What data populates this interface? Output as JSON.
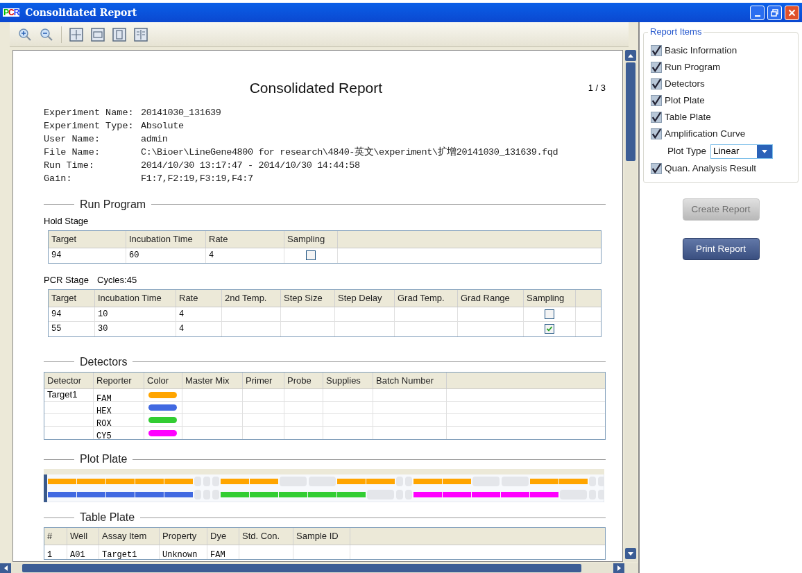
{
  "window": {
    "title": "Consolidated Report",
    "logo": "PCR"
  },
  "report": {
    "title": "Consolidated Report",
    "page": "1 / 3",
    "info": [
      {
        "label": "Experiment Name:",
        "value": "20141030_131639"
      },
      {
        "label": "Experiment Type:",
        "value": "Absolute"
      },
      {
        "label": "User Name:",
        "value": "admin"
      },
      {
        "label": "File Name:",
        "value": "C:\\Bioer\\LineGene4800 for research\\4840-英文\\experiment\\扩增20141030_131639.fqd"
      },
      {
        "label": "Run Time:",
        "value": "2014/10/30 13:17:47 - 2014/10/30 14:44:58"
      },
      {
        "label": "Gain:",
        "value": "F1:7,F2:19,F3:19,F4:7"
      }
    ],
    "run_program": {
      "heading": "Run Program",
      "hold_stage": {
        "label": "Hold Stage",
        "columns": [
          "Target",
          "Incubation Time",
          "Rate",
          "Sampling"
        ],
        "rows": [
          {
            "cells": [
              "94",
              "60",
              "4"
            ],
            "sampling": false
          }
        ]
      },
      "pcr_stage": {
        "label": "PCR Stage",
        "cycles": "Cycles:45",
        "columns": [
          "Target",
          "Incubation Time",
          "Rate",
          "2nd Temp.",
          "Step Size",
          "Step Delay",
          "Grad Temp.",
          "Grad Range",
          "Sampling"
        ],
        "rows": [
          {
            "cells": [
              "94",
              "10",
              "4"
            ],
            "sampling": false
          },
          {
            "cells": [
              "55",
              "30",
              "4"
            ],
            "sampling": true
          }
        ]
      }
    },
    "detectors": {
      "heading": "Detectors",
      "columns": [
        "Detector",
        "Reporter",
        "Color",
        "Master Mix",
        "Primer",
        "Probe",
        "Supplies",
        "Batch Number"
      ],
      "rows": [
        {
          "detector": "Target1",
          "reporter": "FAM",
          "color": "#ffa500"
        },
        {
          "reporter": "HEX",
          "color": "#4169e1"
        },
        {
          "reporter": "ROX",
          "color": "#32cd32"
        },
        {
          "reporter": "CY5",
          "color": "#ff00ff"
        }
      ]
    },
    "plot_plate": {
      "heading": "Plot Plate",
      "rows": [
        {
          "wells": [
            {
              "kind": "assay",
              "color": "#ffa500"
            },
            {
              "kind": "assay",
              "color": "#ffa500"
            },
            {
              "kind": "assay",
              "color": "#ffa500"
            },
            {
              "kind": "assay",
              "color": "#ffa500"
            },
            {
              "kind": "assay",
              "color": "#ffa500"
            },
            {
              "kind": "empty"
            },
            {
              "kind": "empty"
            },
            {
              "kind": "empty"
            },
            {
              "kind": "assay",
              "color": "#ffa500"
            },
            {
              "kind": "assay",
              "color": "#ffa500"
            },
            {
              "kind": "empty"
            },
            {
              "kind": "empty"
            },
            {
              "kind": "assay",
              "color": "#ffa500"
            },
            {
              "kind": "assay",
              "color": "#ffa500"
            },
            {
              "kind": "empty"
            },
            {
              "kind": "empty"
            },
            {
              "kind": "assay",
              "color": "#ffa500"
            },
            {
              "kind": "assay",
              "color": "#ffa500"
            },
            {
              "kind": "empty"
            },
            {
              "kind": "empty"
            },
            {
              "kind": "assay",
              "color": "#ffa500"
            },
            {
              "kind": "assay",
              "color": "#ffa500"
            },
            {
              "kind": "empty"
            },
            {
              "kind": "empty"
            }
          ]
        },
        {
          "wells": [
            {
              "kind": "assay",
              "color": "#4169e1"
            },
            {
              "kind": "assay",
              "color": "#4169e1"
            },
            {
              "kind": "assay",
              "color": "#4169e1"
            },
            {
              "kind": "assay",
              "color": "#4169e1"
            },
            {
              "kind": "assay",
              "color": "#4169e1"
            },
            {
              "kind": "empty"
            },
            {
              "kind": "empty"
            },
            {
              "kind": "empty"
            },
            {
              "kind": "assay",
              "color": "#32cd32"
            },
            {
              "kind": "assay",
              "color": "#32cd32"
            },
            {
              "kind": "assay",
              "color": "#32cd32"
            },
            {
              "kind": "assay",
              "color": "#32cd32"
            },
            {
              "kind": "assay",
              "color": "#32cd32"
            },
            {
              "kind": "empty"
            },
            {
              "kind": "empty"
            },
            {
              "kind": "empty"
            },
            {
              "kind": "assay",
              "color": "#ff00ff"
            },
            {
              "kind": "assay",
              "color": "#ff00ff"
            },
            {
              "kind": "assay",
              "color": "#ff00ff"
            },
            {
              "kind": "assay",
              "color": "#ff00ff"
            },
            {
              "kind": "assay",
              "color": "#ff00ff"
            },
            {
              "kind": "empty"
            },
            {
              "kind": "empty"
            },
            {
              "kind": "empty"
            }
          ]
        }
      ]
    },
    "table_plate": {
      "heading": "Table Plate",
      "columns": [
        "#",
        "Well",
        "Assay Item",
        "Property",
        "Dye",
        "Std. Con.",
        "Sample ID"
      ],
      "rows": [
        {
          "cells": [
            "1",
            "A01",
            "Target1",
            "Unknown",
            "FAM"
          ]
        }
      ]
    }
  },
  "report_items": {
    "legend": "Report Items",
    "items": [
      {
        "kind": "checkbox",
        "label": "Basic Information",
        "checked": true
      },
      {
        "kind": "checkbox",
        "label": "Run Program",
        "checked": true
      },
      {
        "kind": "checkbox",
        "label": "Detectors",
        "checked": true
      },
      {
        "kind": "checkbox",
        "label": "Plot Plate",
        "checked": true
      },
      {
        "kind": "checkbox",
        "label": "Table Plate",
        "checked": true
      },
      {
        "kind": "checkbox",
        "label": "Amplification Curve",
        "checked": true
      },
      {
        "kind": "select",
        "label": "Plot Type",
        "value": "Linear"
      },
      {
        "kind": "checkbox",
        "label": "Quan. Analysis Result",
        "checked": true
      }
    ]
  },
  "buttons": [
    {
      "label": "Create Report",
      "disabled": true
    },
    {
      "label": "Print Report",
      "disabled": false
    }
  ]
}
